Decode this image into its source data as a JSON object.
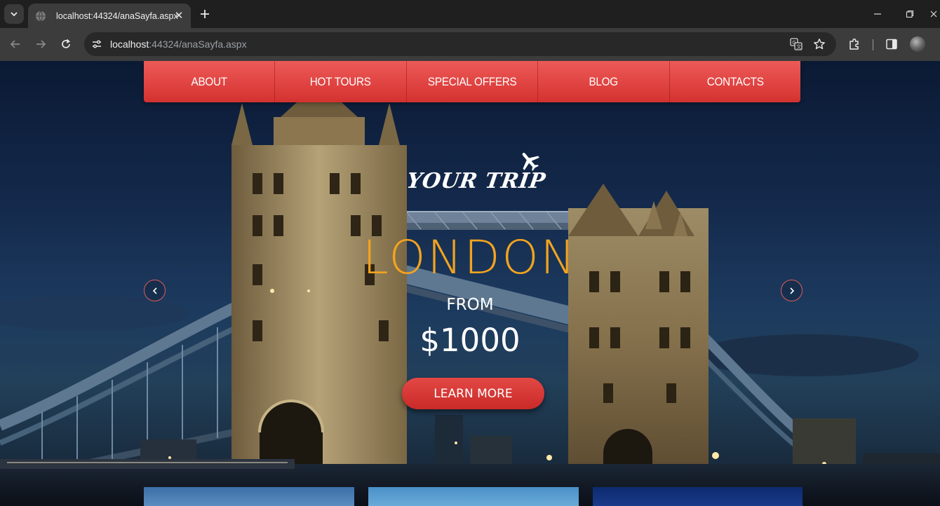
{
  "browser": {
    "tab_title": "localhost:44324/anaSayfa.aspx",
    "url_host": "localhost",
    "url_rest": ":44324/anaSayfa.aspx",
    "icons": [
      "tab-search-icon",
      "globe-icon",
      "close-icon",
      "plus-icon",
      "minimize-icon",
      "restore-icon",
      "back-arrow-icon",
      "forward-arrow-icon",
      "reload-icon",
      "site-info-icon",
      "translate-icon",
      "star-icon",
      "extensions-icon",
      "side-panel-icon",
      "profile-avatar"
    ]
  },
  "menu": {
    "items": [
      {
        "label": "ABOUT"
      },
      {
        "label": "HOT TOURS"
      },
      {
        "label": "SPECIAL OFFERS"
      },
      {
        "label": "BLOG"
      },
      {
        "label": "CONTACTS"
      }
    ],
    "active_index": 0
  },
  "logo": {
    "text": "YOUR TRIP",
    "icon": "airplane-icon"
  },
  "hero": {
    "city": "LONDON",
    "from_label": "FROM",
    "price": "$1000",
    "cta_label": "LEARN MORE"
  },
  "colors": {
    "menu_red": "#e04442",
    "accent_orange": "#f2a31f",
    "cta_red": "#d33532"
  }
}
